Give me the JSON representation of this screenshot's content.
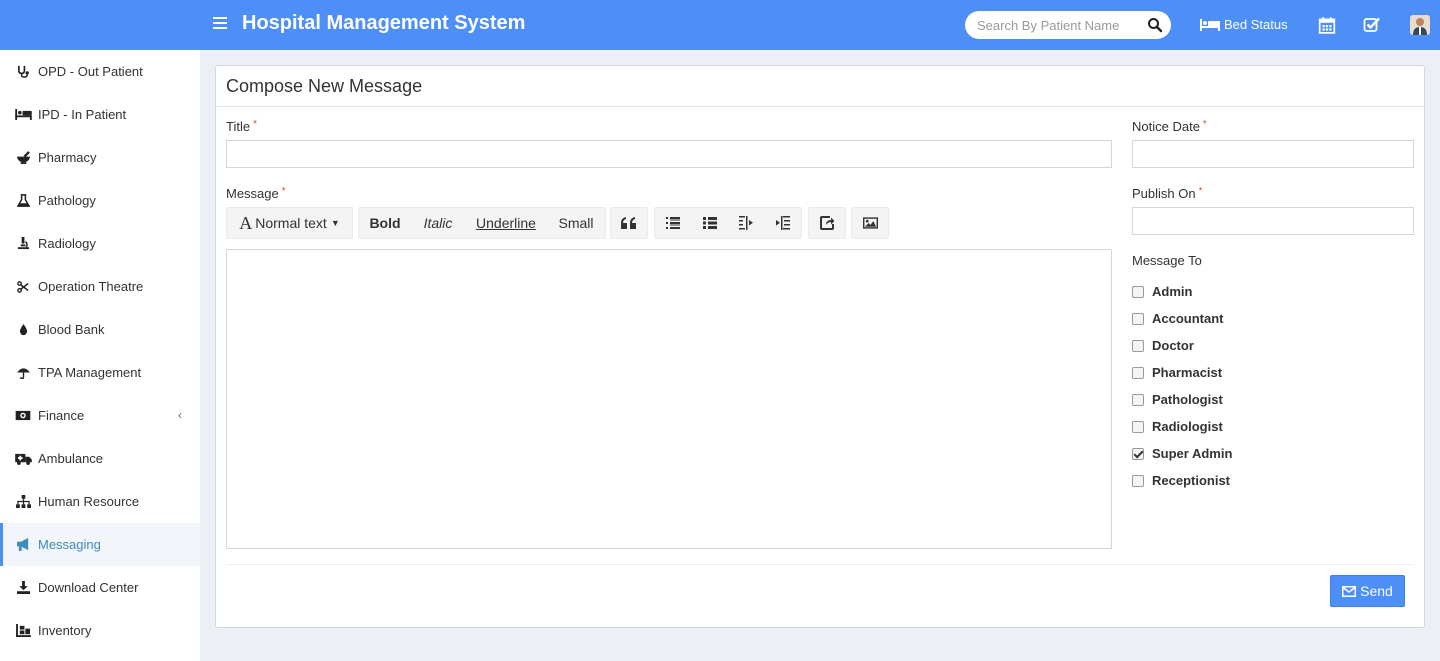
{
  "header": {
    "app_title": "Hospital Management System",
    "search_placeholder": "Search By Patient Name",
    "bed_status_label": "Bed Status",
    "accent_color": "#4e8ff7"
  },
  "sidebar": {
    "items": [
      {
        "label": "OPD - Out Patient",
        "icon": "stethoscope-icon"
      },
      {
        "label": "IPD - In Patient",
        "icon": "bed-icon"
      },
      {
        "label": "Pharmacy",
        "icon": "mortar-pestle-icon"
      },
      {
        "label": "Pathology",
        "icon": "flask-icon"
      },
      {
        "label": "Radiology",
        "icon": "microscope-icon"
      },
      {
        "label": "Operation Theatre",
        "icon": "scissors-icon"
      },
      {
        "label": "Blood Bank",
        "icon": "tint-icon"
      },
      {
        "label": "TPA Management",
        "icon": "umbrella-icon"
      },
      {
        "label": "Finance",
        "icon": "money-icon"
      },
      {
        "label": "Ambulance",
        "icon": "ambulance-icon"
      },
      {
        "label": "Human Resource",
        "icon": "sitemap-icon"
      },
      {
        "label": "Messaging",
        "icon": "bullhorn-icon"
      },
      {
        "label": "Download Center",
        "icon": "download-icon"
      },
      {
        "label": "Inventory",
        "icon": "inventory-icon"
      }
    ],
    "active": "Messaging"
  },
  "compose": {
    "box_title": "Compose New Message",
    "title_label": "Title",
    "title_value": "",
    "message_label": "Message",
    "notice_date_label": "Notice Date",
    "notice_date_value": "",
    "publish_on_label": "Publish On",
    "publish_on_value": "",
    "message_to_label": "Message To",
    "required_mark": "*",
    "toolbar": {
      "normal_text": "Normal text",
      "bold": "Bold",
      "italic": "Italic",
      "underline": "Underline",
      "small": "Small"
    },
    "recipients": [
      {
        "label": "Admin",
        "checked": false
      },
      {
        "label": "Accountant",
        "checked": false
      },
      {
        "label": "Doctor",
        "checked": false
      },
      {
        "label": "Pharmacist",
        "checked": false
      },
      {
        "label": "Pathologist",
        "checked": false
      },
      {
        "label": "Radiologist",
        "checked": false
      },
      {
        "label": "Super Admin",
        "checked": true
      },
      {
        "label": "Receptionist",
        "checked": false
      }
    ],
    "send_label": "Send"
  }
}
